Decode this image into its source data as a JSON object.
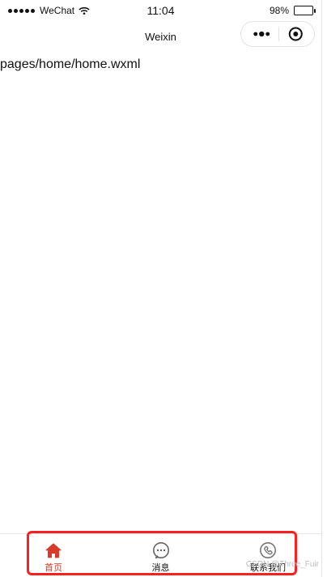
{
  "status_bar": {
    "carrier": "WeChat",
    "time": "11:04",
    "battery_text": "98%",
    "battery_level": 0.98,
    "icons": {
      "signal": "signal-icon",
      "wifi": "wifi-icon",
      "battery": "battery-icon"
    }
  },
  "nav": {
    "title": "Weixin",
    "capsule": {
      "more_icon": "more-icon",
      "close_icon": "close-circle-icon"
    }
  },
  "content": {
    "page_path": "pages/home/home.wxml"
  },
  "tab_bar": {
    "active_color": "#d83b2a",
    "inactive_color": "#111111",
    "items": [
      {
        "label": "首页",
        "icon": "home-icon",
        "active": true
      },
      {
        "label": "消息",
        "icon": "message-icon",
        "active": false
      },
      {
        "label": "联系我们",
        "icon": "phone-icon",
        "active": false
      }
    ]
  },
  "annotation": {
    "highlight_color": "#ff1f1f"
  },
  "watermark": {
    "text": "CSDN @Three_Fuir"
  }
}
